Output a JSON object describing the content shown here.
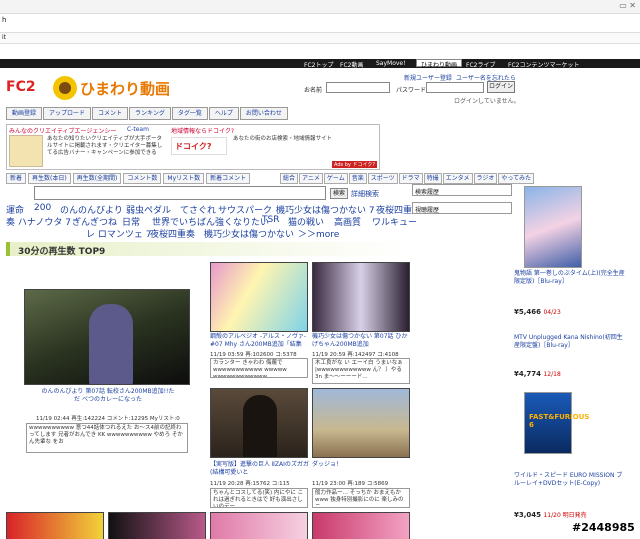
{
  "browser": {
    "toolbar_text": "h",
    "tab_text": "it"
  },
  "nav": {
    "items": [
      "FC2トップ",
      "FC2動画",
      "SayMove!",
      "ひまわり動画",
      "FC2ライブ",
      "FC2コンテンツマーケット"
    ],
    "active_index": 3
  },
  "header": {
    "logo_fc2": "FC2",
    "logo_name": "ひまわり動画",
    "links": [
      "新規ユーザー登録",
      "ユーザー名を忘れたら"
    ],
    "name_label": "お名前",
    "password_label": "パスワード:",
    "login_button": "ログイン",
    "login_status": "ログインしていません。"
  },
  "menu": [
    "動画登録",
    "アップロード",
    "コメント",
    "ランキング",
    "タグ一覧",
    "ヘルプ",
    "お問い合わせ"
  ],
  "ad": {
    "left_title": "みんなのクリエイティブエージェンシー",
    "left_brand": "C-team",
    "left_body": "あなたの知りたいクリエイティブが大手ポータルサイトに掲載されます・クリエイター募集してる広告バナー・キャンペーンに参加できる",
    "right_title": "地域情報ならドコイク?",
    "right_logo": "ドコイク?",
    "right_body": "あなたの街のお店検索・地域情報サイト",
    "adsby": "Ads by ドコイク?"
  },
  "tabs_left": [
    "新着",
    "再生数(本日)",
    "再生数(全期間)",
    "コメント数",
    "Myリスト数",
    "新着コメント"
  ],
  "tabs_right": [
    "総合",
    "アニメ",
    "ゲーム",
    "音楽",
    "スポーツ",
    "ドラマ",
    "特撮",
    "エンタメ",
    "ラジオ",
    "やってみた"
  ],
  "search": {
    "button": "検索",
    "detail_link": "詳細検索",
    "history_label": "検索履歴",
    "view_history_label": "視聴履歴"
  },
  "keywords": {
    "row1": [
      "運命",
      "200",
      "のんのんびより",
      "弱虫ペダル",
      "てさぐれ",
      "サウスパーク",
      "機巧少女は傷つかない 7",
      "夜桜四重"
    ],
    "row2": [
      "奏 ハナノウタ 7",
      "ぎんぎつね",
      "日常",
      "世界でいちばん強くなりたい",
      "TSR",
      "猫の戦い",
      "高画質",
      "ワルキュー"
    ],
    "row3": [
      "レ ロマンツェ 7",
      "夜桜四重奏",
      "機巧少女は傷つかない",
      "＞＞more"
    ]
  },
  "section_title": "30分の再生数 TOP9",
  "videos": [
    {
      "title": "のんのんびより 第07話 転校さん200MB追加!!ただ べつのカレーになった",
      "meta": "11/19 02:44 再生:142224 コメント:12295 Myリスト:0",
      "comment": "wwwwwwwwww 意つ44話体つれるえた お～ス4前の記終わってします 兄者がおんでき KK wwwwwwwwww やめろ そかん先輩な をお"
    },
    {
      "title": "鋼殻のアルベジオ -アルス・ノヴァ- #07 Mhy さん200MB追加「結集",
      "meta": "11/19 03:59 再:102600 コ:5378",
      "comment": "カランター きゃわわ 侮蔑でwwwwwwwwwww wwwww wwwwwwwwwwww..."
    },
    {
      "title": "機巧少女は傷つかない 第07話 ひかげちゃん200MB追加",
      "meta": "11/19 20:59 再:142497 コ:4108",
      "comment": "木工良がな い エーイ白 うまいなぁ |wwwwwwwwwwww ん？ ）やる3n ま～～ーーード…"
    },
    {
      "title": "【実写版】進撃の巨人 ⅡZAIのズガガ(結構可愛いと",
      "meta": "11/19 20:28 再:15762 コ:115",
      "comment": "ちゃんとコスしてる(笑) 内にやに これは過ぎれるときはで 好も演出さしいのデー..."
    },
    {
      "title": "ダッジョ！",
      "meta": "11/19 23:00 再:189 コ:5869",
      "comment": "般力作品ー… そっちか おまえもかwww 独身特別撮影にのに 楽しみのニ..."
    }
  ],
  "sidebar": [
    {
      "title": "鬼物語 第一巻しのぶタイム(上)(完全生産限定版)［Blu-ray］",
      "price": "5,466",
      "rank": "04/23"
    },
    {
      "title": "MTV Unplugged Kana Nishino(初回生産限定盤)［Blu-ray］",
      "price": "4,774",
      "rank": "12/18"
    },
    {
      "title": "ワイルド・スピード EURO MISSION ブルーレイ+DVDセット(E-Copy)",
      "price": "3,045",
      "rank": "11/20 明日発売"
    }
  ],
  "sidebar_cover_text": "FAST&FURIOUS 6",
  "watermark": "#2448985",
  "colors": {
    "nav_bg": "#1a1a1a",
    "link": "#1a3fa0",
    "section_accent": "#9ac137",
    "ad_border": "#e07b7b"
  }
}
